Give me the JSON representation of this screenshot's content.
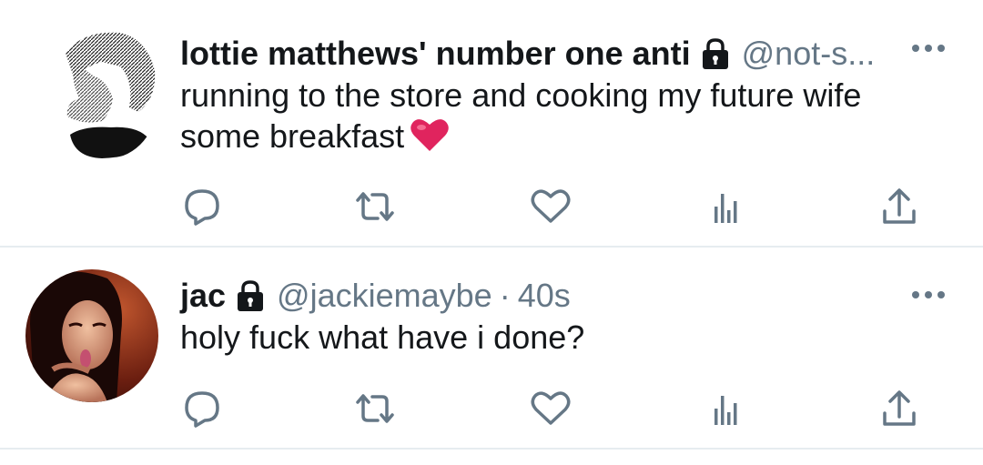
{
  "tweets": [
    {
      "display_name": "lottie matthews' number one anti",
      "handle": "@not-s...",
      "timestamp": "",
      "text_line1": "running to the store and cooking my future wife",
      "text_line2": "some breakfast",
      "emoji": "red-heart",
      "protected": true
    },
    {
      "display_name": "jac",
      "handle": "@jackiemaybe",
      "separator": "·",
      "timestamp": "40s",
      "text_line1": "holy fuck what have i done?",
      "protected": true
    }
  ],
  "icons": [
    "reply-icon",
    "retweet-icon",
    "like-icon",
    "analytics-icon",
    "share-icon",
    "more-icon",
    "lock-icon"
  ],
  "colors": {
    "icon_gray": "#657786",
    "text": "#14171a",
    "divider": "#e6ecf0",
    "heart_red": "#e0245e"
  }
}
